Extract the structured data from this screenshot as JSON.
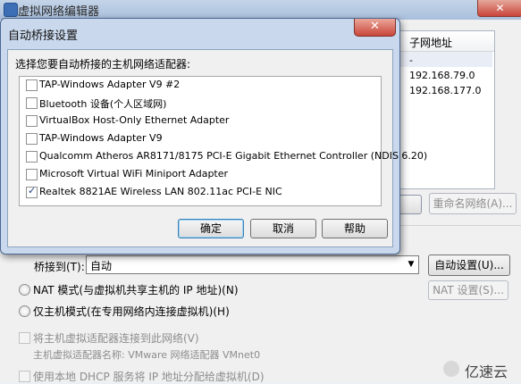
{
  "parent_window": {
    "title": "虚拟网络编辑器",
    "close_glyph": "✕",
    "table": {
      "subnet_header": "子网地址",
      "rows": [
        "-",
        "192.168.79.0",
        "192.168.177.0"
      ]
    },
    "rename_button": "重命名网络(A)...",
    "bridge_to_label": "桥接到(T):",
    "bridge_to_value": "自动",
    "auto_settings_button": "自动设置(U)...",
    "nat_mode_label": "NAT 模式(与虚拟机共享主机的 IP 地址)(N)",
    "nat_settings_button": "NAT 设置(S)...",
    "host_only_label": "仅主机模式(在专用网络内连接虚拟机)(H)",
    "connect_adapter_label": "将主机虚拟适配器连接到此网络(V)",
    "adapter_name_label": "主机虚拟适配器名称: VMware 网络适配器 VMnet0",
    "dhcp_label": "使用本地 DHCP 服务将 IP 地址分配给虚拟机(D)",
    "watermark_text": "亿速云"
  },
  "dialog": {
    "title": "自动桥接设置",
    "close_glyph": "✕",
    "prompt": "选择您要自动桥接的主机网络适配器:",
    "adapters": [
      {
        "label": "TAP-Windows Adapter V9 #2",
        "checked": false
      },
      {
        "label": "Bluetooth 设备(个人区域网)",
        "checked": false
      },
      {
        "label": "VirtualBox Host-Only Ethernet Adapter",
        "checked": false
      },
      {
        "label": "TAP-Windows Adapter V9",
        "checked": false
      },
      {
        "label": "Qualcomm Atheros AR8171/8175 PCI-E Gigabit Ethernet Controller (NDIS 6.20)",
        "checked": false
      },
      {
        "label": "Microsoft Virtual WiFi Miniport Adapter",
        "checked": false
      },
      {
        "label": "Realtek 8821AE Wireless LAN 802.11ac PCI-E NIC",
        "checked": true
      }
    ],
    "ok_button": "确定",
    "cancel_button": "取消",
    "help_button": "帮助"
  },
  "icons": {
    "app_icon": "network-editor-icon",
    "close_icon": "close-icon",
    "dropdown_icon": "chevron-down-icon",
    "check_icon": "checkmark-icon"
  },
  "colors": {
    "dialog_frame": "#c9d8ec",
    "close_button": "#c9463a",
    "client_bg": "#f0f0f0"
  }
}
